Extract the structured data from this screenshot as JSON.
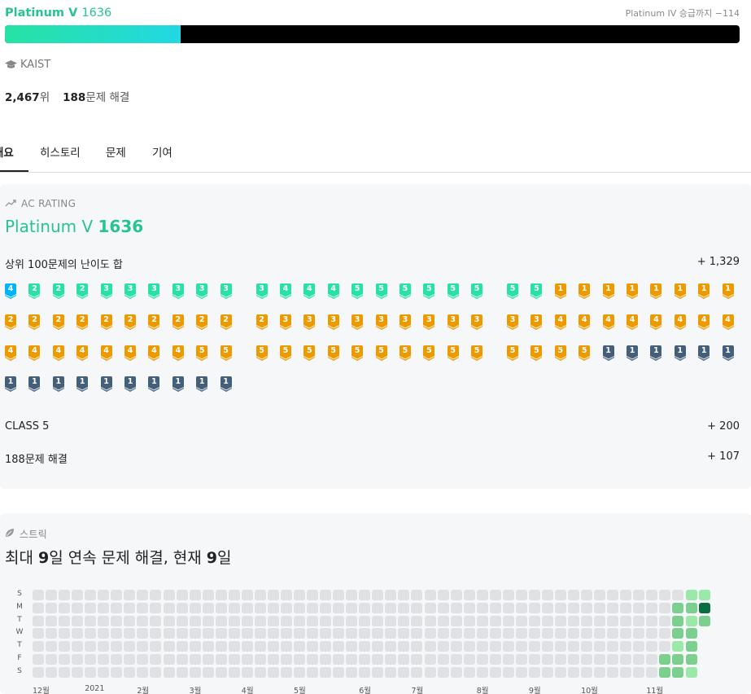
{
  "header": {
    "tier_name": "Platinum V",
    "tier_rating": "1636",
    "next_tier_text": "Platinum IV 승급까지 −114",
    "progress_fraction": 0.2394,
    "progress_color_start": "#27e2a4",
    "progress_color_end": "#22d8e2"
  },
  "profile": {
    "org_icon": "graduation-cap-icon",
    "org": "KAIST",
    "rank_value": "2,467",
    "rank_unit": "위",
    "solved_value": "188",
    "solved_unit": "문제 해결"
  },
  "tabs": [
    {
      "label": "개요",
      "active": true
    },
    {
      "label": "히스토리",
      "active": false
    },
    {
      "label": "문제",
      "active": false
    },
    {
      "label": "기여",
      "active": false
    }
  ],
  "ac_rating": {
    "section_icon": "trending-up-icon",
    "section_label": "AC RATING",
    "tier_name": "Platinum V",
    "tier_rating": "1636",
    "top100_label": "상위 100문제의 난이도 합",
    "top100_value": "+ 1,329",
    "class_label": "CLASS 5",
    "class_value": "+ 200",
    "solved_label": "188문제 해결",
    "solved_value": "+ 107",
    "tier_colors": {
      "bronze": "#ad5600",
      "silver": "#435f7a",
      "gold": "#ec9a00",
      "platinum": "#27e2a4",
      "diamond": "#00b4fc"
    },
    "badge_rows": [
      [
        {
          "t": "diamond",
          "l": "4"
        },
        {
          "t": "platinum",
          "l": "2"
        },
        {
          "t": "platinum",
          "l": "2"
        },
        {
          "t": "platinum",
          "l": "2"
        },
        {
          "t": "platinum",
          "l": "3"
        },
        {
          "t": "platinum",
          "l": "3"
        },
        {
          "t": "platinum",
          "l": "3"
        },
        {
          "t": "platinum",
          "l": "3"
        },
        {
          "t": "platinum",
          "l": "3"
        },
        {
          "t": "platinum",
          "l": "3"
        },
        {
          "t": "platinum",
          "l": "3"
        },
        {
          "t": "platinum",
          "l": "4"
        },
        {
          "t": "platinum",
          "l": "4"
        },
        {
          "t": "platinum",
          "l": "4"
        },
        {
          "t": "platinum",
          "l": "5"
        },
        {
          "t": "platinum",
          "l": "5"
        },
        {
          "t": "platinum",
          "l": "5"
        },
        {
          "t": "platinum",
          "l": "5"
        },
        {
          "t": "platinum",
          "l": "5"
        },
        {
          "t": "platinum",
          "l": "5"
        },
        {
          "t": "platinum",
          "l": "5"
        },
        {
          "t": "platinum",
          "l": "5"
        },
        {
          "t": "gold",
          "l": "1"
        },
        {
          "t": "gold",
          "l": "1"
        },
        {
          "t": "gold",
          "l": "1"
        },
        {
          "t": "gold",
          "l": "1"
        },
        {
          "t": "gold",
          "l": "1"
        },
        {
          "t": "gold",
          "l": "1"
        },
        {
          "t": "gold",
          "l": "1"
        },
        {
          "t": "gold",
          "l": "1"
        }
      ],
      [
        {
          "t": "gold",
          "l": "2"
        },
        {
          "t": "gold",
          "l": "2"
        },
        {
          "t": "gold",
          "l": "2"
        },
        {
          "t": "gold",
          "l": "2"
        },
        {
          "t": "gold",
          "l": "2"
        },
        {
          "t": "gold",
          "l": "2"
        },
        {
          "t": "gold",
          "l": "2"
        },
        {
          "t": "gold",
          "l": "2"
        },
        {
          "t": "gold",
          "l": "2"
        },
        {
          "t": "gold",
          "l": "2"
        },
        {
          "t": "gold",
          "l": "2"
        },
        {
          "t": "gold",
          "l": "3"
        },
        {
          "t": "gold",
          "l": "3"
        },
        {
          "t": "gold",
          "l": "3"
        },
        {
          "t": "gold",
          "l": "3"
        },
        {
          "t": "gold",
          "l": "3"
        },
        {
          "t": "gold",
          "l": "3"
        },
        {
          "t": "gold",
          "l": "3"
        },
        {
          "t": "gold",
          "l": "3"
        },
        {
          "t": "gold",
          "l": "3"
        },
        {
          "t": "gold",
          "l": "3"
        },
        {
          "t": "gold",
          "l": "3"
        },
        {
          "t": "gold",
          "l": "4"
        },
        {
          "t": "gold",
          "l": "4"
        },
        {
          "t": "gold",
          "l": "4"
        },
        {
          "t": "gold",
          "l": "4"
        },
        {
          "t": "gold",
          "l": "4"
        },
        {
          "t": "gold",
          "l": "4"
        },
        {
          "t": "gold",
          "l": "4"
        },
        {
          "t": "gold",
          "l": "4"
        }
      ],
      [
        {
          "t": "gold",
          "l": "4"
        },
        {
          "t": "gold",
          "l": "4"
        },
        {
          "t": "gold",
          "l": "4"
        },
        {
          "t": "gold",
          "l": "4"
        },
        {
          "t": "gold",
          "l": "4"
        },
        {
          "t": "gold",
          "l": "4"
        },
        {
          "t": "gold",
          "l": "4"
        },
        {
          "t": "gold",
          "l": "4"
        },
        {
          "t": "gold",
          "l": "5"
        },
        {
          "t": "gold",
          "l": "5"
        },
        {
          "t": "gold",
          "l": "5"
        },
        {
          "t": "gold",
          "l": "5"
        },
        {
          "t": "gold",
          "l": "5"
        },
        {
          "t": "gold",
          "l": "5"
        },
        {
          "t": "gold",
          "l": "5"
        },
        {
          "t": "gold",
          "l": "5"
        },
        {
          "t": "gold",
          "l": "5"
        },
        {
          "t": "gold",
          "l": "5"
        },
        {
          "t": "gold",
          "l": "5"
        },
        {
          "t": "gold",
          "l": "5"
        },
        {
          "t": "gold",
          "l": "5"
        },
        {
          "t": "gold",
          "l": "5"
        },
        {
          "t": "gold",
          "l": "5"
        },
        {
          "t": "gold",
          "l": "5"
        },
        {
          "t": "silver",
          "l": "1"
        },
        {
          "t": "silver",
          "l": "1"
        },
        {
          "t": "silver",
          "l": "1"
        },
        {
          "t": "silver",
          "l": "1"
        },
        {
          "t": "silver",
          "l": "1"
        },
        {
          "t": "silver",
          "l": "1"
        }
      ],
      [
        {
          "t": "silver",
          "l": "1"
        },
        {
          "t": "silver",
          "l": "1"
        },
        {
          "t": "silver",
          "l": "1"
        },
        {
          "t": "silver",
          "l": "1"
        },
        {
          "t": "silver",
          "l": "1"
        },
        {
          "t": "silver",
          "l": "1"
        },
        {
          "t": "silver",
          "l": "1"
        },
        {
          "t": "silver",
          "l": "1"
        },
        {
          "t": "silver",
          "l": "1"
        },
        {
          "t": "silver",
          "l": "1"
        }
      ]
    ]
  },
  "streak": {
    "section_icon": "leaf-icon",
    "section_label": "스트릭",
    "title_prefix": "최대 ",
    "max_streak": "9",
    "title_middle": "일 연속 문제 해결, 현재 ",
    "current_streak": "9",
    "title_suffix": "일",
    "day_labels": [
      "S",
      "M",
      "T",
      "W",
      "T",
      "F",
      "S"
    ],
    "month_labels": [
      {
        "label": "12월",
        "week": 0
      },
      {
        "label": "2021",
        "week": 4
      },
      {
        "label": "2월",
        "week": 8
      },
      {
        "label": "3월",
        "week": 12
      },
      {
        "label": "4월",
        "week": 16
      },
      {
        "label": "5월",
        "week": 20
      },
      {
        "label": "6월",
        "week": 25
      },
      {
        "label": "7월",
        "week": 29
      },
      {
        "label": "8월",
        "week": 34
      },
      {
        "label": "9월",
        "week": 38
      },
      {
        "label": "10월",
        "week": 42
      },
      {
        "label": "11월",
        "week": 47
      }
    ],
    "weeks": 52,
    "level_colors": [
      "#dfe1e5",
      "#9be9a8",
      "#7ccf8f",
      "#40c463",
      "#0a6e43"
    ],
    "active_days": [
      {
        "week": 48,
        "day": 6,
        "level": 2
      },
      {
        "week": 48,
        "day": 5,
        "level": 2
      },
      {
        "week": 49,
        "day": 1,
        "level": 2
      },
      {
        "week": 49,
        "day": 2,
        "level": 2
      },
      {
        "week": 49,
        "day": 3,
        "level": 2
      },
      {
        "week": 49,
        "day": 4,
        "level": 1
      },
      {
        "week": 49,
        "day": 5,
        "level": 2
      },
      {
        "week": 49,
        "day": 6,
        "level": 2
      },
      {
        "week": 50,
        "day": 0,
        "level": 1
      },
      {
        "week": 50,
        "day": 1,
        "level": 2
      },
      {
        "week": 50,
        "day": 2,
        "level": 1
      },
      {
        "week": 50,
        "day": 3,
        "level": 2
      },
      {
        "week": 50,
        "day": 4,
        "level": 2
      },
      {
        "week": 50,
        "day": 5,
        "level": 2
      },
      {
        "week": 50,
        "day": 6,
        "level": 1
      },
      {
        "week": 51,
        "day": 0,
        "level": 1
      },
      {
        "week": 51,
        "day": 1,
        "level": 4
      },
      {
        "week": 51,
        "day": 2,
        "level": 2
      }
    ],
    "visible_days": {
      "51": 3
    }
  }
}
